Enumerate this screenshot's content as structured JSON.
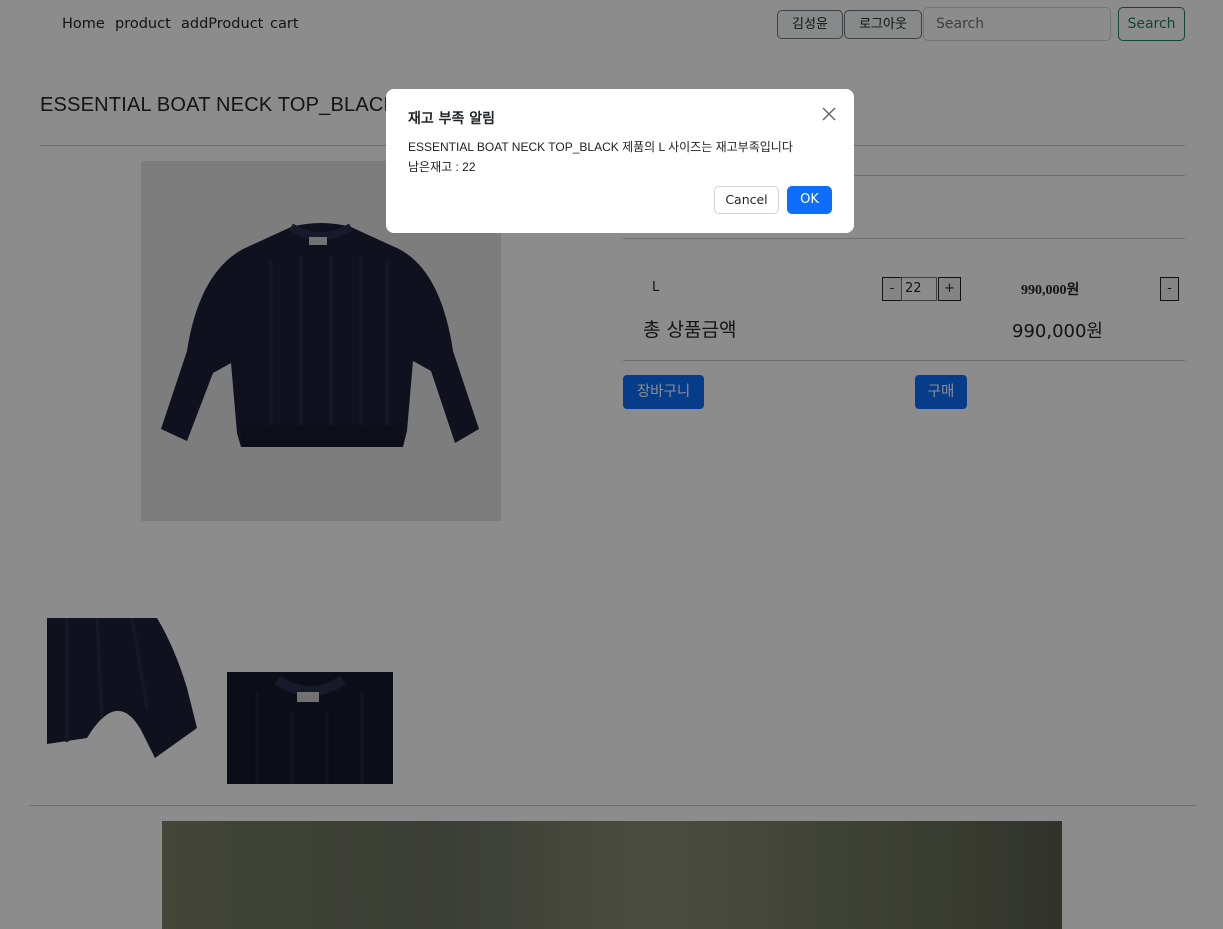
{
  "nav": {
    "links": [
      "Home",
      "product",
      "addProduct",
      "cart"
    ],
    "user_label": "김성윤",
    "logout_label": "로그아웃",
    "search_placeholder": "Search",
    "search_button": "Search"
  },
  "product": {
    "title": "ESSENTIAL BOAT NECK TOP_BLACK",
    "option": {
      "size": "L",
      "minus": "-",
      "quantity": "22",
      "plus": "+",
      "price": "990,000원",
      "remove": "-"
    },
    "total_label": "총 상품금액",
    "total_value": "990,000원",
    "cart_button": "장바구니",
    "buy_button": "구매"
  },
  "modal": {
    "title": "재고 부족 알림",
    "message_line1": "ESSENTIAL BOAT NECK TOP_BLACK 제품의 L 사이즈는 재고부족입니다",
    "message_line2": "남은재고 : 22",
    "cancel_label": "Cancel",
    "ok_label": "OK"
  },
  "colors": {
    "primary": "#0d6efd",
    "success": "#198754",
    "sweater": "#1c2038"
  }
}
